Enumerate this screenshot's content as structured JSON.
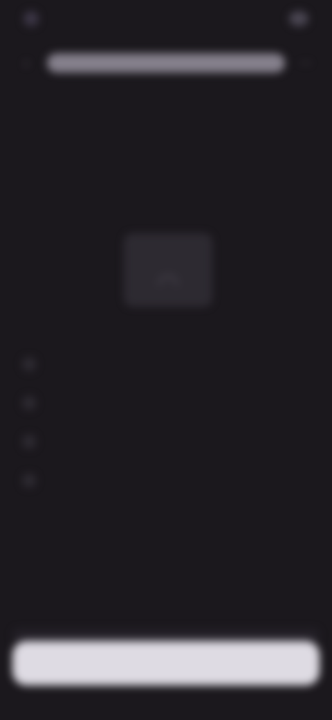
{
  "status_bar": {
    "time": "",
    "signal": ""
  },
  "top_bar": {
    "back_icon": "arrow-left-icon",
    "address_text": "",
    "more_icon": "more-icon"
  },
  "title": {
    "line1": "",
    "line2": ""
  },
  "device_card": {
    "icon": "wifi-icon"
  },
  "steps": [
    {
      "text": ""
    },
    {
      "text": ""
    },
    {
      "text": ""
    },
    {
      "text": ""
    }
  ],
  "primary_button": {
    "label": ""
  },
  "colors": {
    "background": "#1b181d",
    "button": "#dedbe3",
    "address_pill": "#85808c"
  }
}
